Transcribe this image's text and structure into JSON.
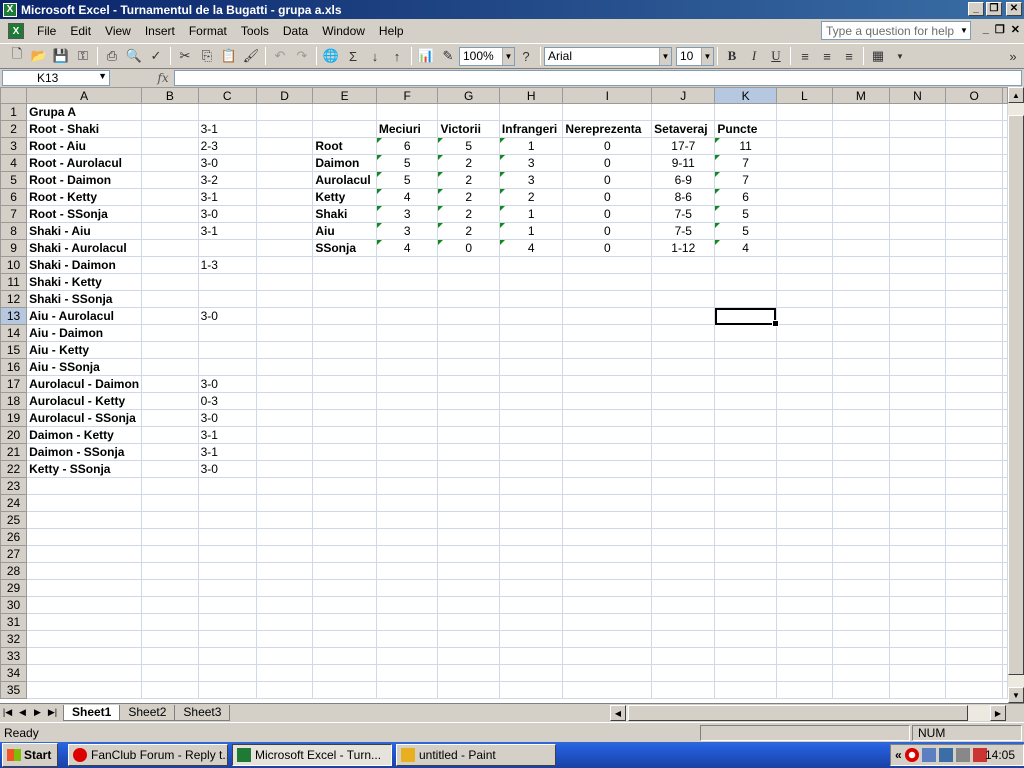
{
  "window": {
    "app_icon": "excel-icon",
    "title": "Microsoft Excel - Turnamentul de la Bugatti - grupa a.xls",
    "minimize": "_",
    "restore": "❐",
    "close": "✕"
  },
  "menu": {
    "items": [
      "File",
      "Edit",
      "View",
      "Insert",
      "Format",
      "Tools",
      "Data",
      "Window",
      "Help"
    ],
    "help_placeholder": "Type a question for help"
  },
  "toolbar": {
    "zoom": "100%",
    "font": "Arial",
    "font_size": "10",
    "bold": "B",
    "italic": "I",
    "underline": "U"
  },
  "formula_bar": {
    "name_box": "K13",
    "fx": "fx",
    "formula": ""
  },
  "grid": {
    "columns": [
      "A",
      "B",
      "C",
      "D",
      "E",
      "F",
      "G",
      "H",
      "I",
      "J",
      "K",
      "L",
      "M",
      "N",
      "O"
    ],
    "rows": [
      "1",
      "2",
      "3",
      "4",
      "5",
      "6",
      "7",
      "8",
      "9",
      "10",
      "11",
      "12",
      "13",
      "14",
      "15",
      "16",
      "17",
      "18",
      "19",
      "20",
      "21",
      "22",
      "23",
      "24",
      "25",
      "26",
      "27",
      "28",
      "29",
      "30",
      "31",
      "32",
      "33",
      "34",
      "35"
    ],
    "active_cell": "K13",
    "col_a": [
      "Grupa A",
      "Root - Shaki",
      "Root - Aiu",
      "Root - Aurolacul",
      "Root - Daimon",
      "Root - Ketty",
      "Root - SSonja",
      "Shaki - Aiu",
      "Shaki - Aurolacul",
      "Shaki - Daimon",
      "Shaki - Ketty",
      "Shaki - SSonja",
      "Aiu - Aurolacul",
      "Aiu - Daimon",
      "Aiu - Ketty",
      "Aiu - SSonja",
      "Aurolacul - Daimon",
      "Aurolacul - Ketty",
      "Aurolacul - SSonja",
      "Daimon - Ketty",
      "Daimon - SSonja",
      "Ketty - SSonja"
    ],
    "col_c": [
      "",
      "3-1",
      "2-3",
      "3-0",
      "3-2",
      "3-1",
      "3-0",
      "3-1",
      "",
      "1-3",
      "",
      "",
      "3-0",
      "",
      "",
      "",
      "3-0",
      "0-3",
      "3-0",
      "3-1",
      "3-1",
      "3-0"
    ],
    "standings_headers": [
      "Meciuri",
      "Victorii",
      "Infrangeri",
      "Nereprezenta",
      "Setaveraj",
      "Puncte"
    ],
    "standings": [
      {
        "team": "Root",
        "meciuri": "6",
        "victorii": "5",
        "infrangeri": "1",
        "nereprezenta": "0",
        "setaveraj": "17-7",
        "puncte": "11"
      },
      {
        "team": "Daimon",
        "meciuri": "5",
        "victorii": "2",
        "infrangeri": "3",
        "nereprezenta": "0",
        "setaveraj": "9-11",
        "puncte": "7"
      },
      {
        "team": "Aurolacul",
        "meciuri": "5",
        "victorii": "2",
        "infrangeri": "3",
        "nereprezenta": "0",
        "setaveraj": "6-9",
        "puncte": "7"
      },
      {
        "team": "Ketty",
        "meciuri": "4",
        "victorii": "2",
        "infrangeri": "2",
        "nereprezenta": "0",
        "setaveraj": "8-6",
        "puncte": "6"
      },
      {
        "team": "Shaki",
        "meciuri": "3",
        "victorii": "2",
        "infrangeri": "1",
        "nereprezenta": "0",
        "setaveraj": "7-5",
        "puncte": "5"
      },
      {
        "team": "Aiu",
        "meciuri": "3",
        "victorii": "2",
        "infrangeri": "1",
        "nereprezenta": "0",
        "setaveraj": "7-5",
        "puncte": "5"
      },
      {
        "team": "SSonja",
        "meciuri": "4",
        "victorii": "0",
        "infrangeri": "4",
        "nereprezenta": "0",
        "setaveraj": "1-12",
        "puncte": "4"
      }
    ]
  },
  "sheet_tabs": [
    "Sheet1",
    "Sheet2",
    "Sheet3"
  ],
  "active_sheet": "Sheet1",
  "status": {
    "ready": "Ready",
    "num": "NUM"
  },
  "taskbar": {
    "start": "Start",
    "tasks": [
      {
        "label": "FanClub Forum - Reply t...",
        "icon": "opera-icon",
        "active": false
      },
      {
        "label": "Microsoft Excel - Turn...",
        "icon": "excel-icon",
        "active": true
      },
      {
        "label": "untitled - Paint",
        "icon": "paint-icon",
        "active": false
      }
    ],
    "tray_expand": "«",
    "clock": "14:05"
  },
  "colors": {
    "title_start": "#0a246a",
    "title_end": "#3a6ea5",
    "chrome": "#d4d0c8",
    "taskbar": "#245edb",
    "gridline": "#d0d7e5",
    "comment_marker": "#108a20"
  }
}
